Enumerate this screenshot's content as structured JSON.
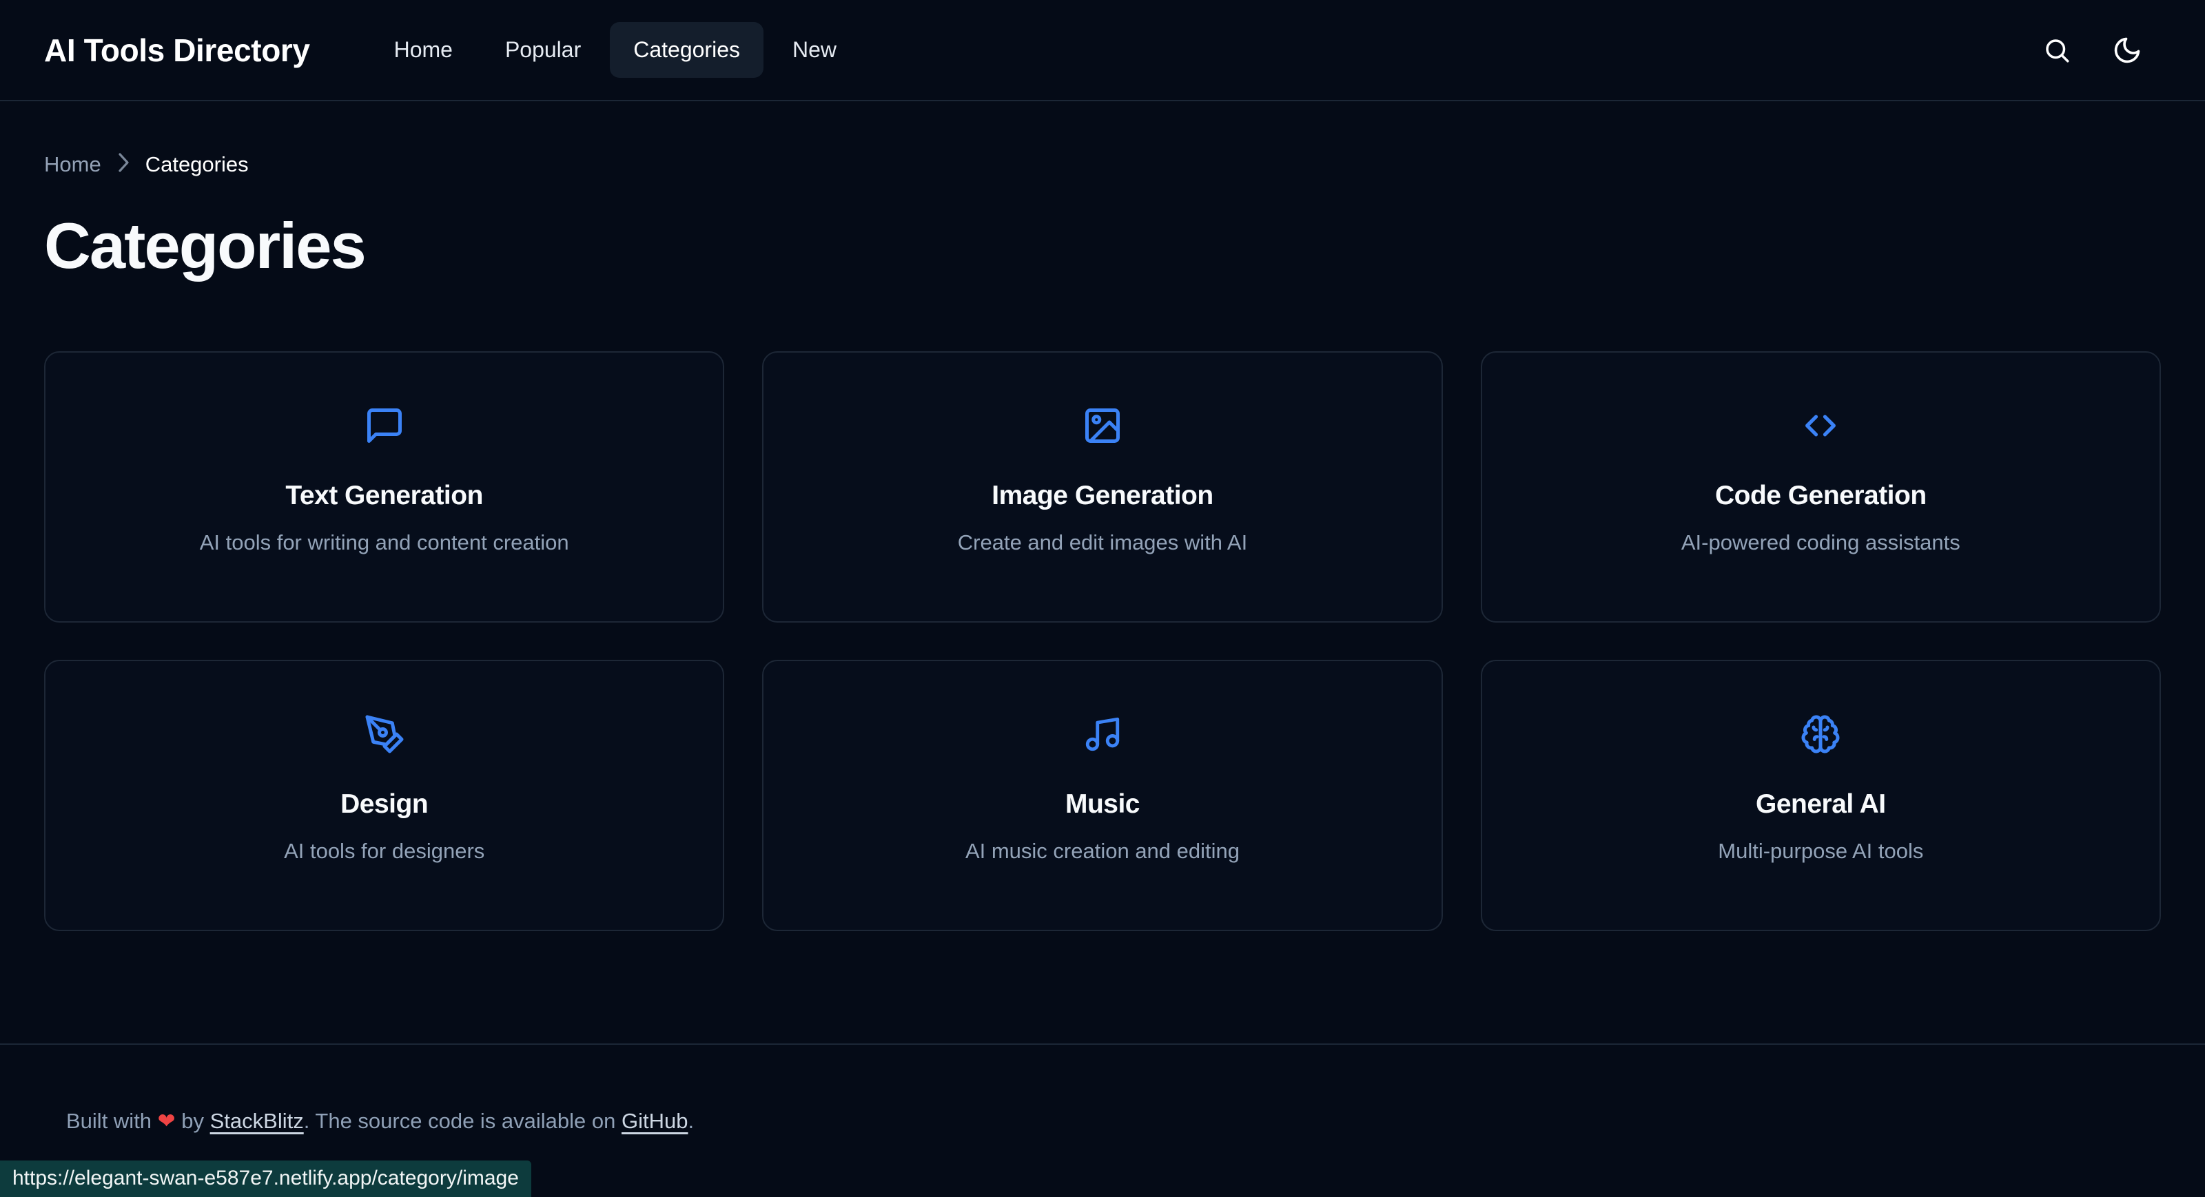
{
  "header": {
    "brand": "AI Tools Directory",
    "nav": [
      {
        "label": "Home",
        "active": false
      },
      {
        "label": "Popular",
        "active": false
      },
      {
        "label": "Categories",
        "active": true
      },
      {
        "label": "New",
        "active": false
      }
    ],
    "actions": [
      {
        "name": "search-icon",
        "label": "Search"
      },
      {
        "name": "moon-icon",
        "label": "Toggle dark mode"
      }
    ]
  },
  "breadcrumb": {
    "home": "Home",
    "separator": "›",
    "current": "Categories"
  },
  "page": {
    "title": "Categories"
  },
  "categories": [
    {
      "icon": "message-square-icon",
      "title": "Text Generation",
      "description": "AI tools for writing and content creation"
    },
    {
      "icon": "image-icon",
      "title": "Image Generation",
      "description": "Create and edit images with AI"
    },
    {
      "icon": "code-icon",
      "title": "Code Generation",
      "description": "AI-powered coding assistants"
    },
    {
      "icon": "pen-tool-icon",
      "title": "Design",
      "description": "AI tools for designers"
    },
    {
      "icon": "music-note-icon",
      "title": "Music",
      "description": "AI music creation and editing"
    },
    {
      "icon": "brain-icon",
      "title": "General AI",
      "description": "Multi-purpose AI tools"
    }
  ],
  "footer": {
    "built_with": "Built with ",
    "heart": "❤",
    "by": " by ",
    "stackblitz": "StackBlitz",
    "middle": ". The source code is available on ",
    "github": "GitHub",
    "end": "."
  },
  "status_bar": {
    "url": "https://elegant-swan-e587e7.netlify.app/category/image"
  },
  "colors": {
    "background": "#050b17",
    "accent": "#3b82f6",
    "card_border": "#1d2736",
    "muted_text": "#93a3b8",
    "heart": "#ef4444",
    "status_bg": "#0d3b3d"
  }
}
